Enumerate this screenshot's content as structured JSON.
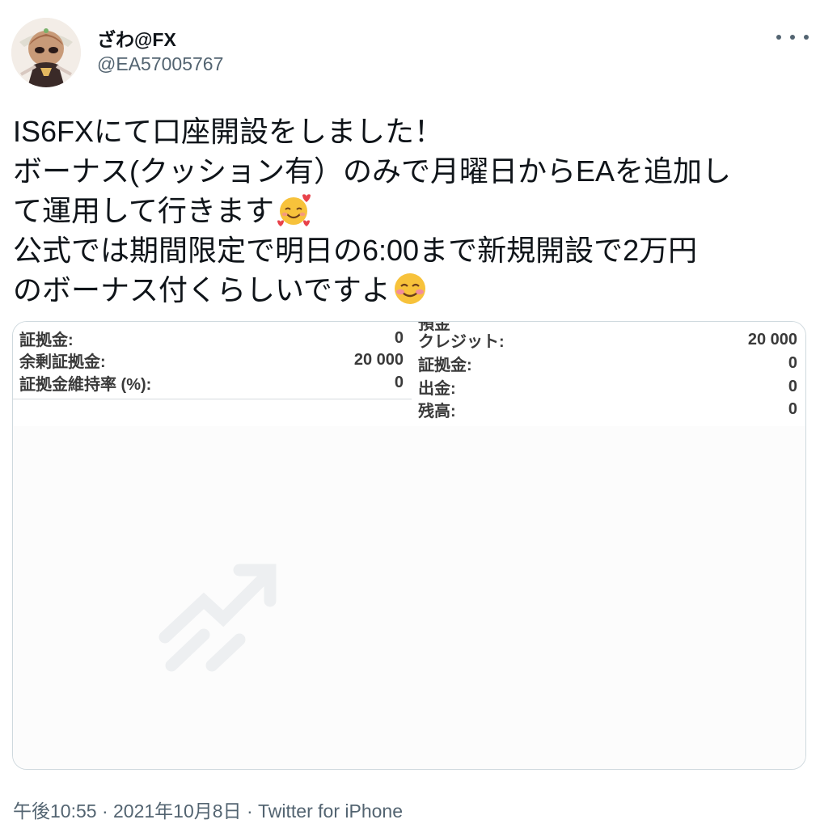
{
  "author": {
    "display_name": "ざわ@FX",
    "handle": "@EA57005767"
  },
  "tweet": {
    "lines": [
      "IS6FXにて口座開設をしました！",
      "ボーナス(クッション有）のみで月曜日からEAを追加し",
      "て運用して行きます",
      "公式では期間限定で明日の6:00まで新規開設で2万円",
      "のボーナス付くらしいですよ"
    ],
    "emojis": [
      "smiling-face-with-hearts",
      "smiling-face-with-blush"
    ]
  },
  "media": {
    "left_rows": [
      {
        "label": "証拠金:",
        "value": "0"
      },
      {
        "label": "余剰証拠金:",
        "value": "20 000"
      },
      {
        "label": "証拠金維持率 (%):",
        "value": "0"
      }
    ],
    "right_cut_label": "預金",
    "right_rows": [
      {
        "label": "クレジット:",
        "value": "20 000"
      },
      {
        "label": "証拠金:",
        "value": "0"
      },
      {
        "label": "出金:",
        "value": "0"
      },
      {
        "label": "残高:",
        "value": "0"
      }
    ]
  },
  "meta": {
    "time": "午後10:55",
    "separator1": " · ",
    "date": "2021年10月8日",
    "separator2": " · ",
    "source": "Twitter for iPhone"
  },
  "colors": {
    "text": "#0f1419",
    "secondary": "#536471",
    "border": "#cfd9de"
  }
}
